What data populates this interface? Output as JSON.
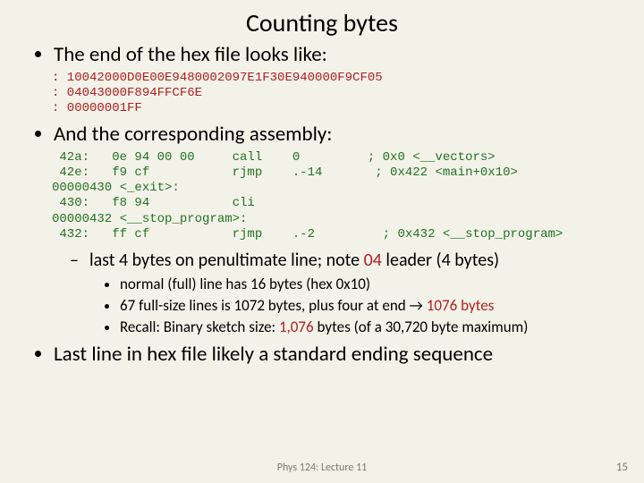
{
  "title": "Counting bytes",
  "bullets": {
    "b1": "The end of the hex file looks like:",
    "hex_block": ": 10042000D0E00E9480002097E1F30E940000F9CF05\n: 04043000F894FFCF6E\n: 00000001FF",
    "b2": "And the corresponding assembly:",
    "asm_block": " 42a:   0e 94 00 00     call    0         ; 0x0 <__vectors>\n 42e:   f9 cf           rjmp    .-14       ; 0x422 <main+0x10>\n00000430 <_exit>:\n 430:   f8 94           cli\n00000432 <__stop_program>:\n 432:   ff cf           rjmp    .-2         ; 0x432 <__stop_program>",
    "sub1_pre": "last 4 bytes on penultimate line; note ",
    "sub1_red": "04",
    "sub1_post": " leader (4 bytes)",
    "t1": "normal (full) line has 16 bytes (hex 0x10)",
    "t2_pre": "67 full-size lines is 1072 bytes, plus four at end → ",
    "t2_red": "1076 bytes",
    "t3_pre": "Recall: Binary sketch size: ",
    "t3_red": "1,076",
    "t3_post": " bytes (of a 30,720 byte maximum)",
    "b3": "Last line in hex file likely a standard ending sequence"
  },
  "footer": "Phys 124: Lecture 11",
  "page": "15"
}
